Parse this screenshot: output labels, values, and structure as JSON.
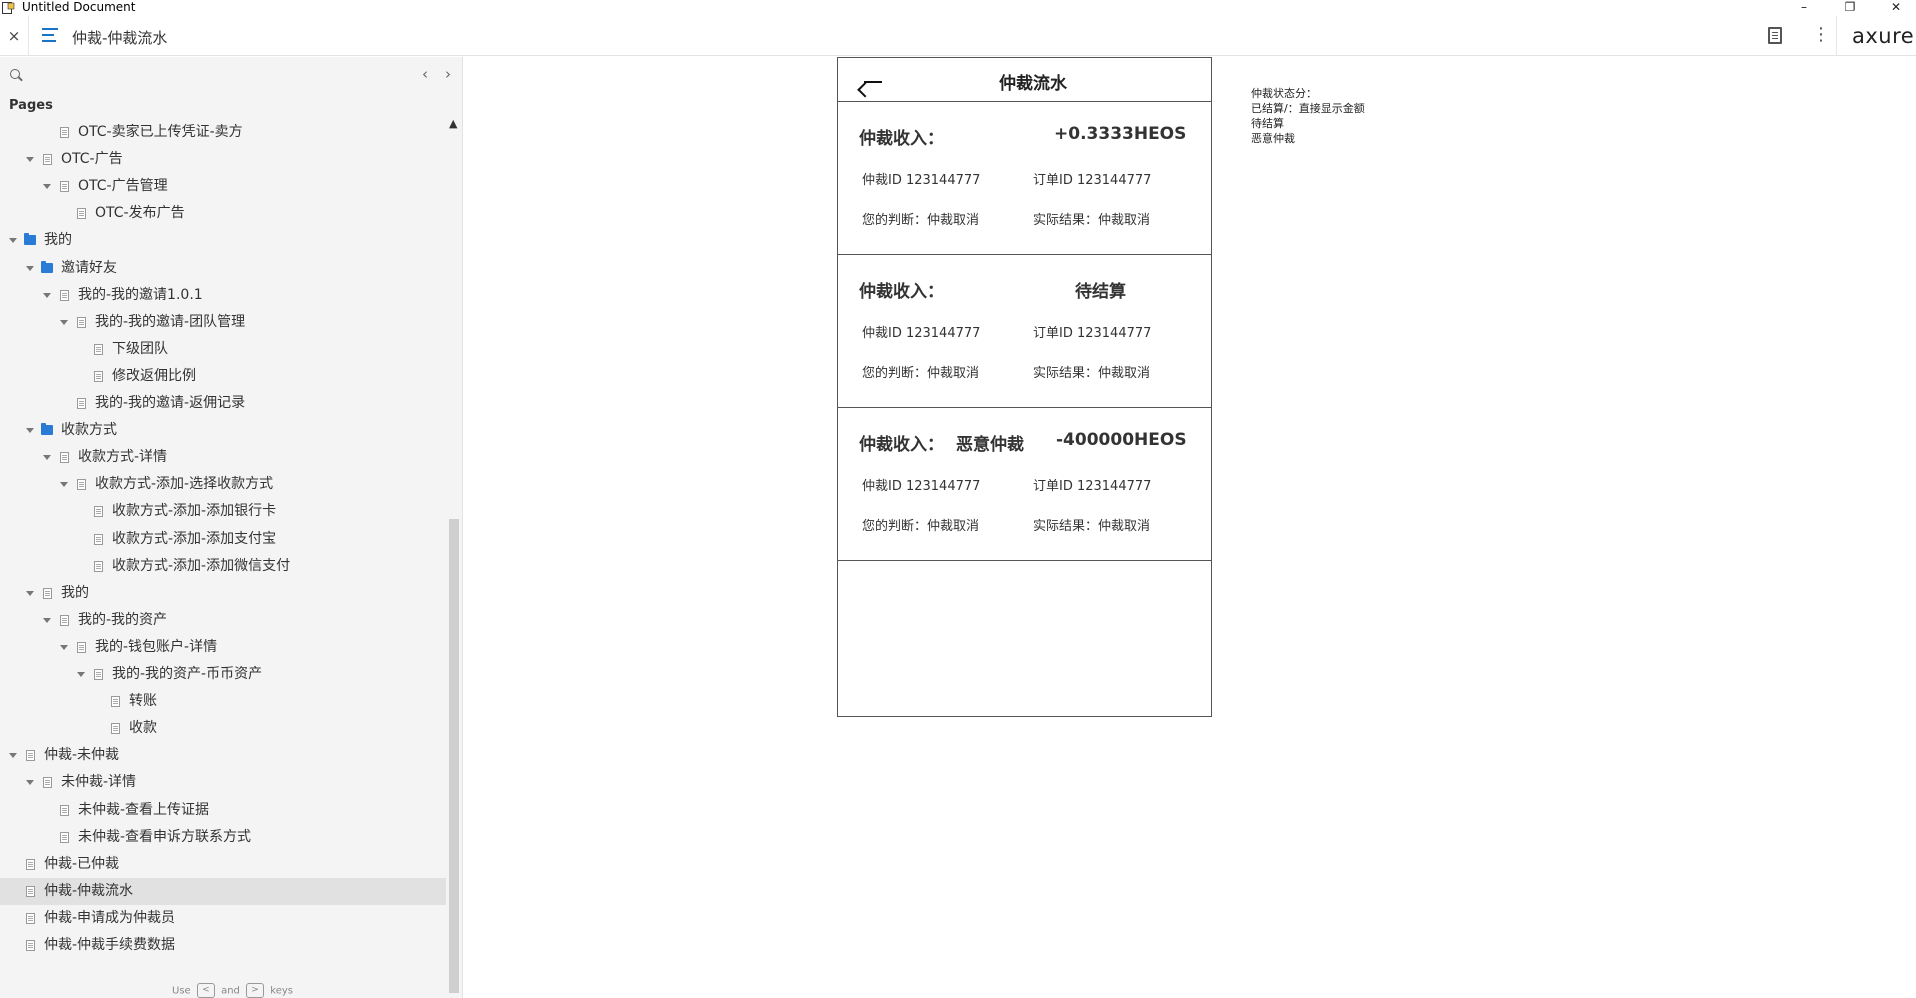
{
  "window": {
    "title": "Untitled Document",
    "minimize": "–",
    "restore": "❐",
    "close": "✕"
  },
  "toolbar": {
    "close_label": "×",
    "page_title": "仲裁-仲裁流水",
    "more_label": "⋮",
    "logo": "axure"
  },
  "sidebar": {
    "prev": "‹",
    "next": "›",
    "pages_label": "Pages",
    "scroll_up": "▲",
    "scroll_down": "▼",
    "hint": {
      "use": "Use",
      "key_left": "<",
      "and": "and",
      "key_right": ">",
      "keys": "keys"
    },
    "items": [
      {
        "label": "OTC-卖家已上传凭证-卖方",
        "level": 3,
        "type": "page",
        "toggle": false
      },
      {
        "label": "OTC-广告",
        "level": 2,
        "type": "page",
        "toggle": true
      },
      {
        "label": "OTC-广告管理",
        "level": 3,
        "type": "page",
        "toggle": true
      },
      {
        "label": "OTC-发布广告",
        "level": 4,
        "type": "page",
        "toggle": false
      },
      {
        "label": "我的",
        "level": 1,
        "type": "folder",
        "toggle": true
      },
      {
        "label": "邀请好友",
        "level": 2,
        "type": "folder",
        "toggle": true
      },
      {
        "label": "我的-我的邀请1.0.1",
        "level": 3,
        "type": "page",
        "toggle": true
      },
      {
        "label": "我的-我的邀请-团队管理",
        "level": 4,
        "type": "page",
        "toggle": true
      },
      {
        "label": "下级团队",
        "level": 5,
        "type": "page",
        "toggle": false
      },
      {
        "label": "修改返佣比例",
        "level": 5,
        "type": "page",
        "toggle": false
      },
      {
        "label": "我的-我的邀请-返佣记录",
        "level": 4,
        "type": "page",
        "toggle": false
      },
      {
        "label": "收款方式",
        "level": 2,
        "type": "folder",
        "toggle": true
      },
      {
        "label": "收款方式-详情",
        "level": 3,
        "type": "page",
        "toggle": true
      },
      {
        "label": "收款方式-添加-选择收款方式",
        "level": 4,
        "type": "page",
        "toggle": true
      },
      {
        "label": "收款方式-添加-添加银行卡",
        "level": 5,
        "type": "page",
        "toggle": false
      },
      {
        "label": "收款方式-添加-添加支付宝",
        "level": 5,
        "type": "page",
        "toggle": false
      },
      {
        "label": "收款方式-添加-添加微信支付",
        "level": 5,
        "type": "page",
        "toggle": false
      },
      {
        "label": "我的",
        "level": 2,
        "type": "page",
        "toggle": true
      },
      {
        "label": "我的-我的资产",
        "level": 3,
        "type": "page",
        "toggle": true
      },
      {
        "label": "我的-钱包账户-详情",
        "level": 4,
        "type": "page",
        "toggle": true
      },
      {
        "label": "我的-我的资产-币币资产",
        "level": 5,
        "type": "page",
        "toggle": true
      },
      {
        "label": "转账",
        "level": 6,
        "type": "page",
        "toggle": false
      },
      {
        "label": "收款",
        "level": 6,
        "type": "page",
        "toggle": false
      },
      {
        "label": "仲裁-未仲裁",
        "level": 1,
        "type": "page",
        "toggle": true
      },
      {
        "label": "未仲裁-详情",
        "level": 2,
        "type": "page",
        "toggle": true
      },
      {
        "label": "未仲裁-查看上传证据",
        "level": 3,
        "type": "page",
        "toggle": false
      },
      {
        "label": "未仲裁-查看申诉方联系方式",
        "level": 3,
        "type": "page",
        "toggle": false
      },
      {
        "label": "仲裁-已仲裁",
        "level": 1,
        "type": "page",
        "toggle": false
      },
      {
        "label": "仲裁-仲裁流水",
        "level": 1,
        "type": "page",
        "toggle": false,
        "selected": true
      },
      {
        "label": "仲裁-申请成为仲裁员",
        "level": 1,
        "type": "page",
        "toggle": false
      },
      {
        "label": "仲裁-仲裁手续费数据",
        "level": 1,
        "type": "page",
        "toggle": false
      }
    ]
  },
  "phone": {
    "title": "仲裁流水",
    "cards": [
      {
        "label": "仲裁收入：",
        "status": "",
        "amount": "+0.3333HEOS",
        "arb_id": "仲裁ID  123144777",
        "order_id": "订单ID  123144777",
        "judgment": "您的判断：仲裁取消",
        "result": "实际结果：仲裁取消"
      },
      {
        "label": "仲裁收入：",
        "status": "待结算",
        "amount": "",
        "arb_id": "仲裁ID  123144777",
        "order_id": "订单ID  123144777",
        "judgment": "您的判断：仲裁取消",
        "result": "实际结果：仲裁取消"
      },
      {
        "label": "仲裁收入：",
        "status": "恶意仲裁",
        "amount": "-400000HEOS",
        "arb_id": "仲裁ID  123144777",
        "order_id": "订单ID  123144777",
        "judgment": "您的判断：仲裁取消",
        "result": "实际结果：仲裁取消"
      }
    ]
  },
  "notes": {
    "lines": [
      "仲裁状态分：",
      "已结算/：直接显示金额",
      "待结算",
      "恶意仲裁"
    ]
  },
  "colors": {
    "accent": "#2a7bd6",
    "selected_bg": "#e1e1e1",
    "sidebar_bg": "#f4f4f4"
  }
}
